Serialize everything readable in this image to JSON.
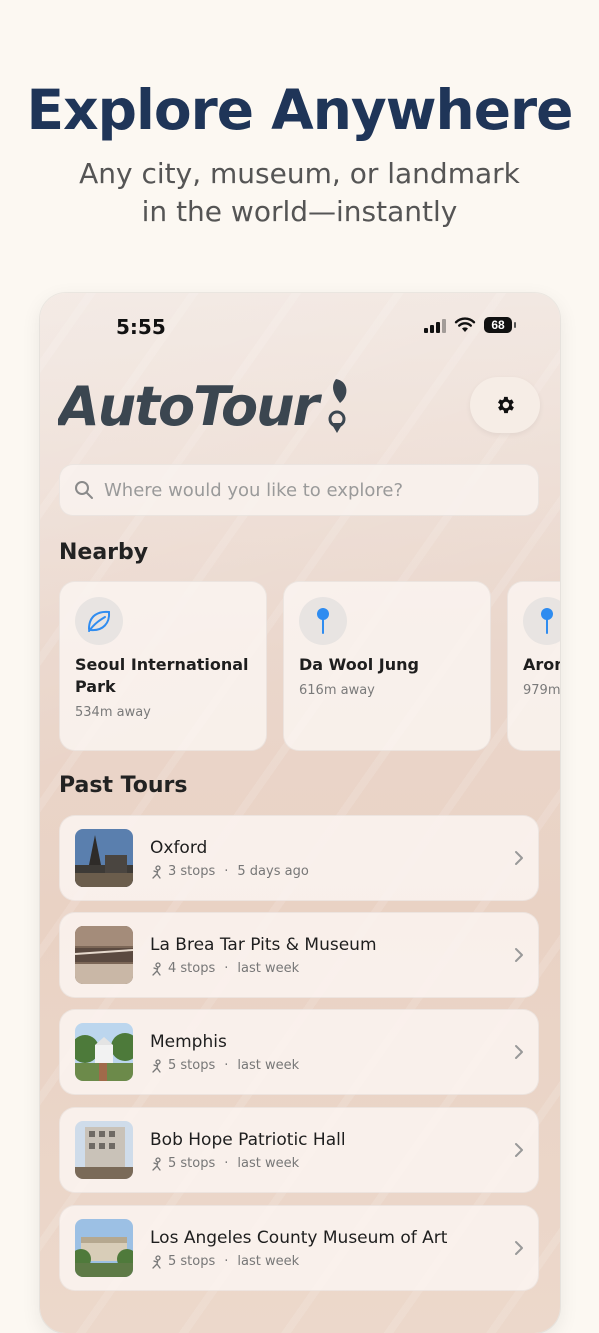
{
  "hero": {
    "title": "Explore Anywhere",
    "subtitle_line1": "Any city, museum, or landmark",
    "subtitle_line2": "in the world—instantly"
  },
  "status_bar": {
    "time": "5:55",
    "battery": "68"
  },
  "app": {
    "logo_text": "AutoTour"
  },
  "search": {
    "placeholder": "Where would you like to explore?"
  },
  "sections": {
    "nearby": "Nearby",
    "past_tours": "Past Tours"
  },
  "nearby": [
    {
      "name": "Seoul International Park",
      "distance": "534m away",
      "icon": "leaf-icon"
    },
    {
      "name": "Da Wool Jung",
      "distance": "616m away",
      "icon": "pin-icon"
    },
    {
      "name": "Aron",
      "distance": "979m",
      "icon": "pin-icon"
    }
  ],
  "past_tours": [
    {
      "name": "Oxford",
      "stops": "3 stops",
      "when": "5 days ago"
    },
    {
      "name": "La Brea Tar Pits & Museum",
      "stops": "4 stops",
      "when": "last week"
    },
    {
      "name": "Memphis",
      "stops": "5 stops",
      "when": "last week"
    },
    {
      "name": "Bob Hope Patriotic Hall",
      "stops": "5 stops",
      "when": "last week"
    },
    {
      "name": "Los Angeles County Museum of Art",
      "stops": "5 stops",
      "when": "last week"
    }
  ],
  "colors": {
    "headline": "#1f3558",
    "accent_blue": "#2f8cf0",
    "logo": "#3b4650"
  }
}
